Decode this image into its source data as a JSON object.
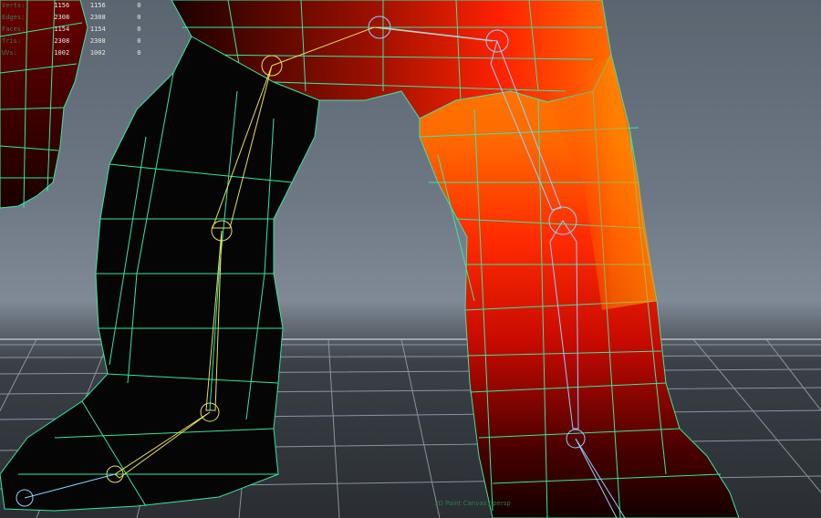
{
  "hud": {
    "rows": [
      {
        "label": "Verts:",
        "v1": "1156",
        "v2": "1156",
        "v3": "0"
      },
      {
        "label": "Edges:",
        "v1": "2308",
        "v2": "2308",
        "v3": "0"
      },
      {
        "label": "Faces:",
        "v1": "1154",
        "v2": "1154",
        "v3": "0"
      },
      {
        "label": "Tris:",
        "v1": "2308",
        "v2": "2308",
        "v3": "0"
      },
      {
        "label": "UVs:",
        "v1": "1002",
        "v2": "1002",
        "v3": "0"
      }
    ]
  },
  "camera_label": "3D Paint Canvas / persp",
  "colors": {
    "wireframe": "#39e6a0",
    "joint_yellow": "#e8e05a",
    "joint_blue": "#8fd0ff",
    "paint_hot": "#ff5a00",
    "paint_dark": "#000000",
    "grid": "#9aa3ad"
  }
}
